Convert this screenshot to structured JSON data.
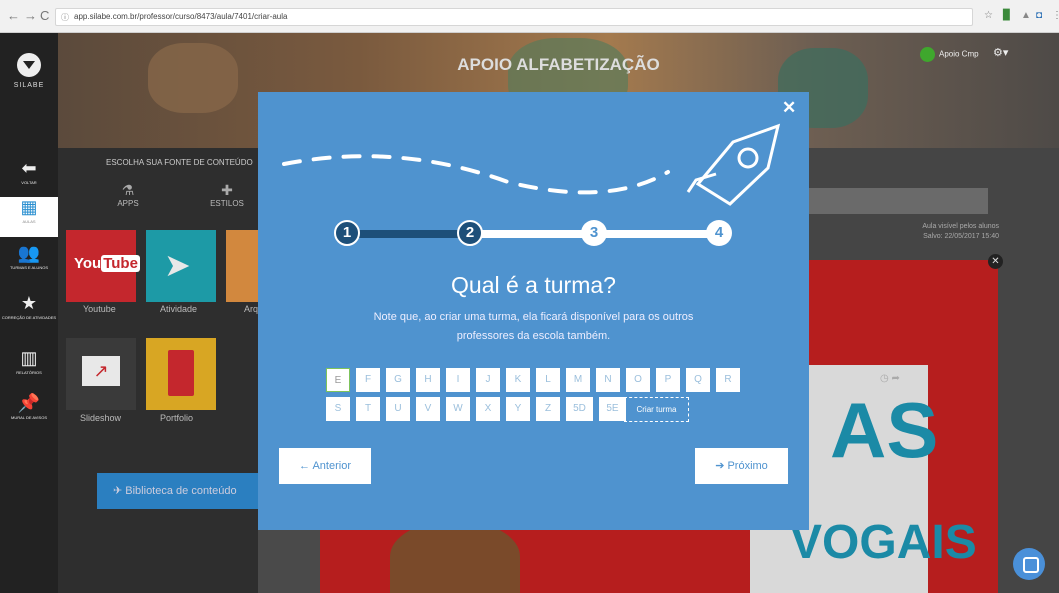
{
  "browser": {
    "url": "app.silabe.com.br/professor/curso/8473/aula/7401/criar-aula"
  },
  "sidebar": {
    "logo": "SILABE",
    "items": [
      {
        "label": "VOLTAR",
        "icon": "arrow-left-icon"
      },
      {
        "label": "AULAS",
        "icon": "grid-icon"
      },
      {
        "label": "TURMAS E ALUNOS",
        "icon": "users-icon"
      },
      {
        "label": "CORREÇÃO DE ATIVIDADES",
        "icon": "star-icon"
      },
      {
        "label": "RELATÓRIOS",
        "icon": "bar-chart-icon"
      },
      {
        "label": "MURAL DE AVISOS",
        "icon": "pin-icon"
      }
    ]
  },
  "header": {
    "title": "APOIO ALFABETIZAÇÃO",
    "user": "Apoio Cmp"
  },
  "content_panel": {
    "title": "ESCOLHA SUA FONTE DE CONTEÚDO",
    "tabs": [
      {
        "label": "APPS"
      },
      {
        "label": "ESTILOS"
      }
    ],
    "tiles": [
      {
        "label": "Youtube",
        "color": "#c4272d"
      },
      {
        "label": "Atividade",
        "color": "#1d9aa6"
      },
      {
        "label": "Arq",
        "color": "#d2883e"
      },
      {
        "label": "Slideshow",
        "color": "#3a3a3a"
      },
      {
        "label": "Portfolio",
        "color": "#d8a623"
      }
    ],
    "library_button": "Biblioteca de conteúdo"
  },
  "right_panel": {
    "visibility": "Aula visível pelos alunos",
    "saved": "Salvo: 22/05/2017 15:40",
    "poster_words": [
      "AS",
      "VOGAIS"
    ]
  },
  "modal": {
    "steps": [
      "1",
      "2",
      "3",
      "4"
    ],
    "current_step": 2,
    "title": "Qual é a turma?",
    "subtitle": "Note que, ao criar uma turma, ela ficará disponível para os outros professores da escola também.",
    "letters_row1": [
      "E",
      "F",
      "G",
      "H",
      "I",
      "J",
      "K",
      "L",
      "M",
      "N",
      "O",
      "P",
      "Q",
      "R"
    ],
    "letters_row2": [
      "S",
      "T",
      "U",
      "V",
      "W",
      "X",
      "Y",
      "Z",
      "5D",
      "5E"
    ],
    "selected_letter": "E",
    "create_class": "Criar turma",
    "prev_button": "← Anterior",
    "next_button": "➔ Próximo"
  },
  "colors": {
    "modal": "#4f93cf",
    "step_done": "#1d4f79",
    "accent": "#2a8fd0"
  }
}
